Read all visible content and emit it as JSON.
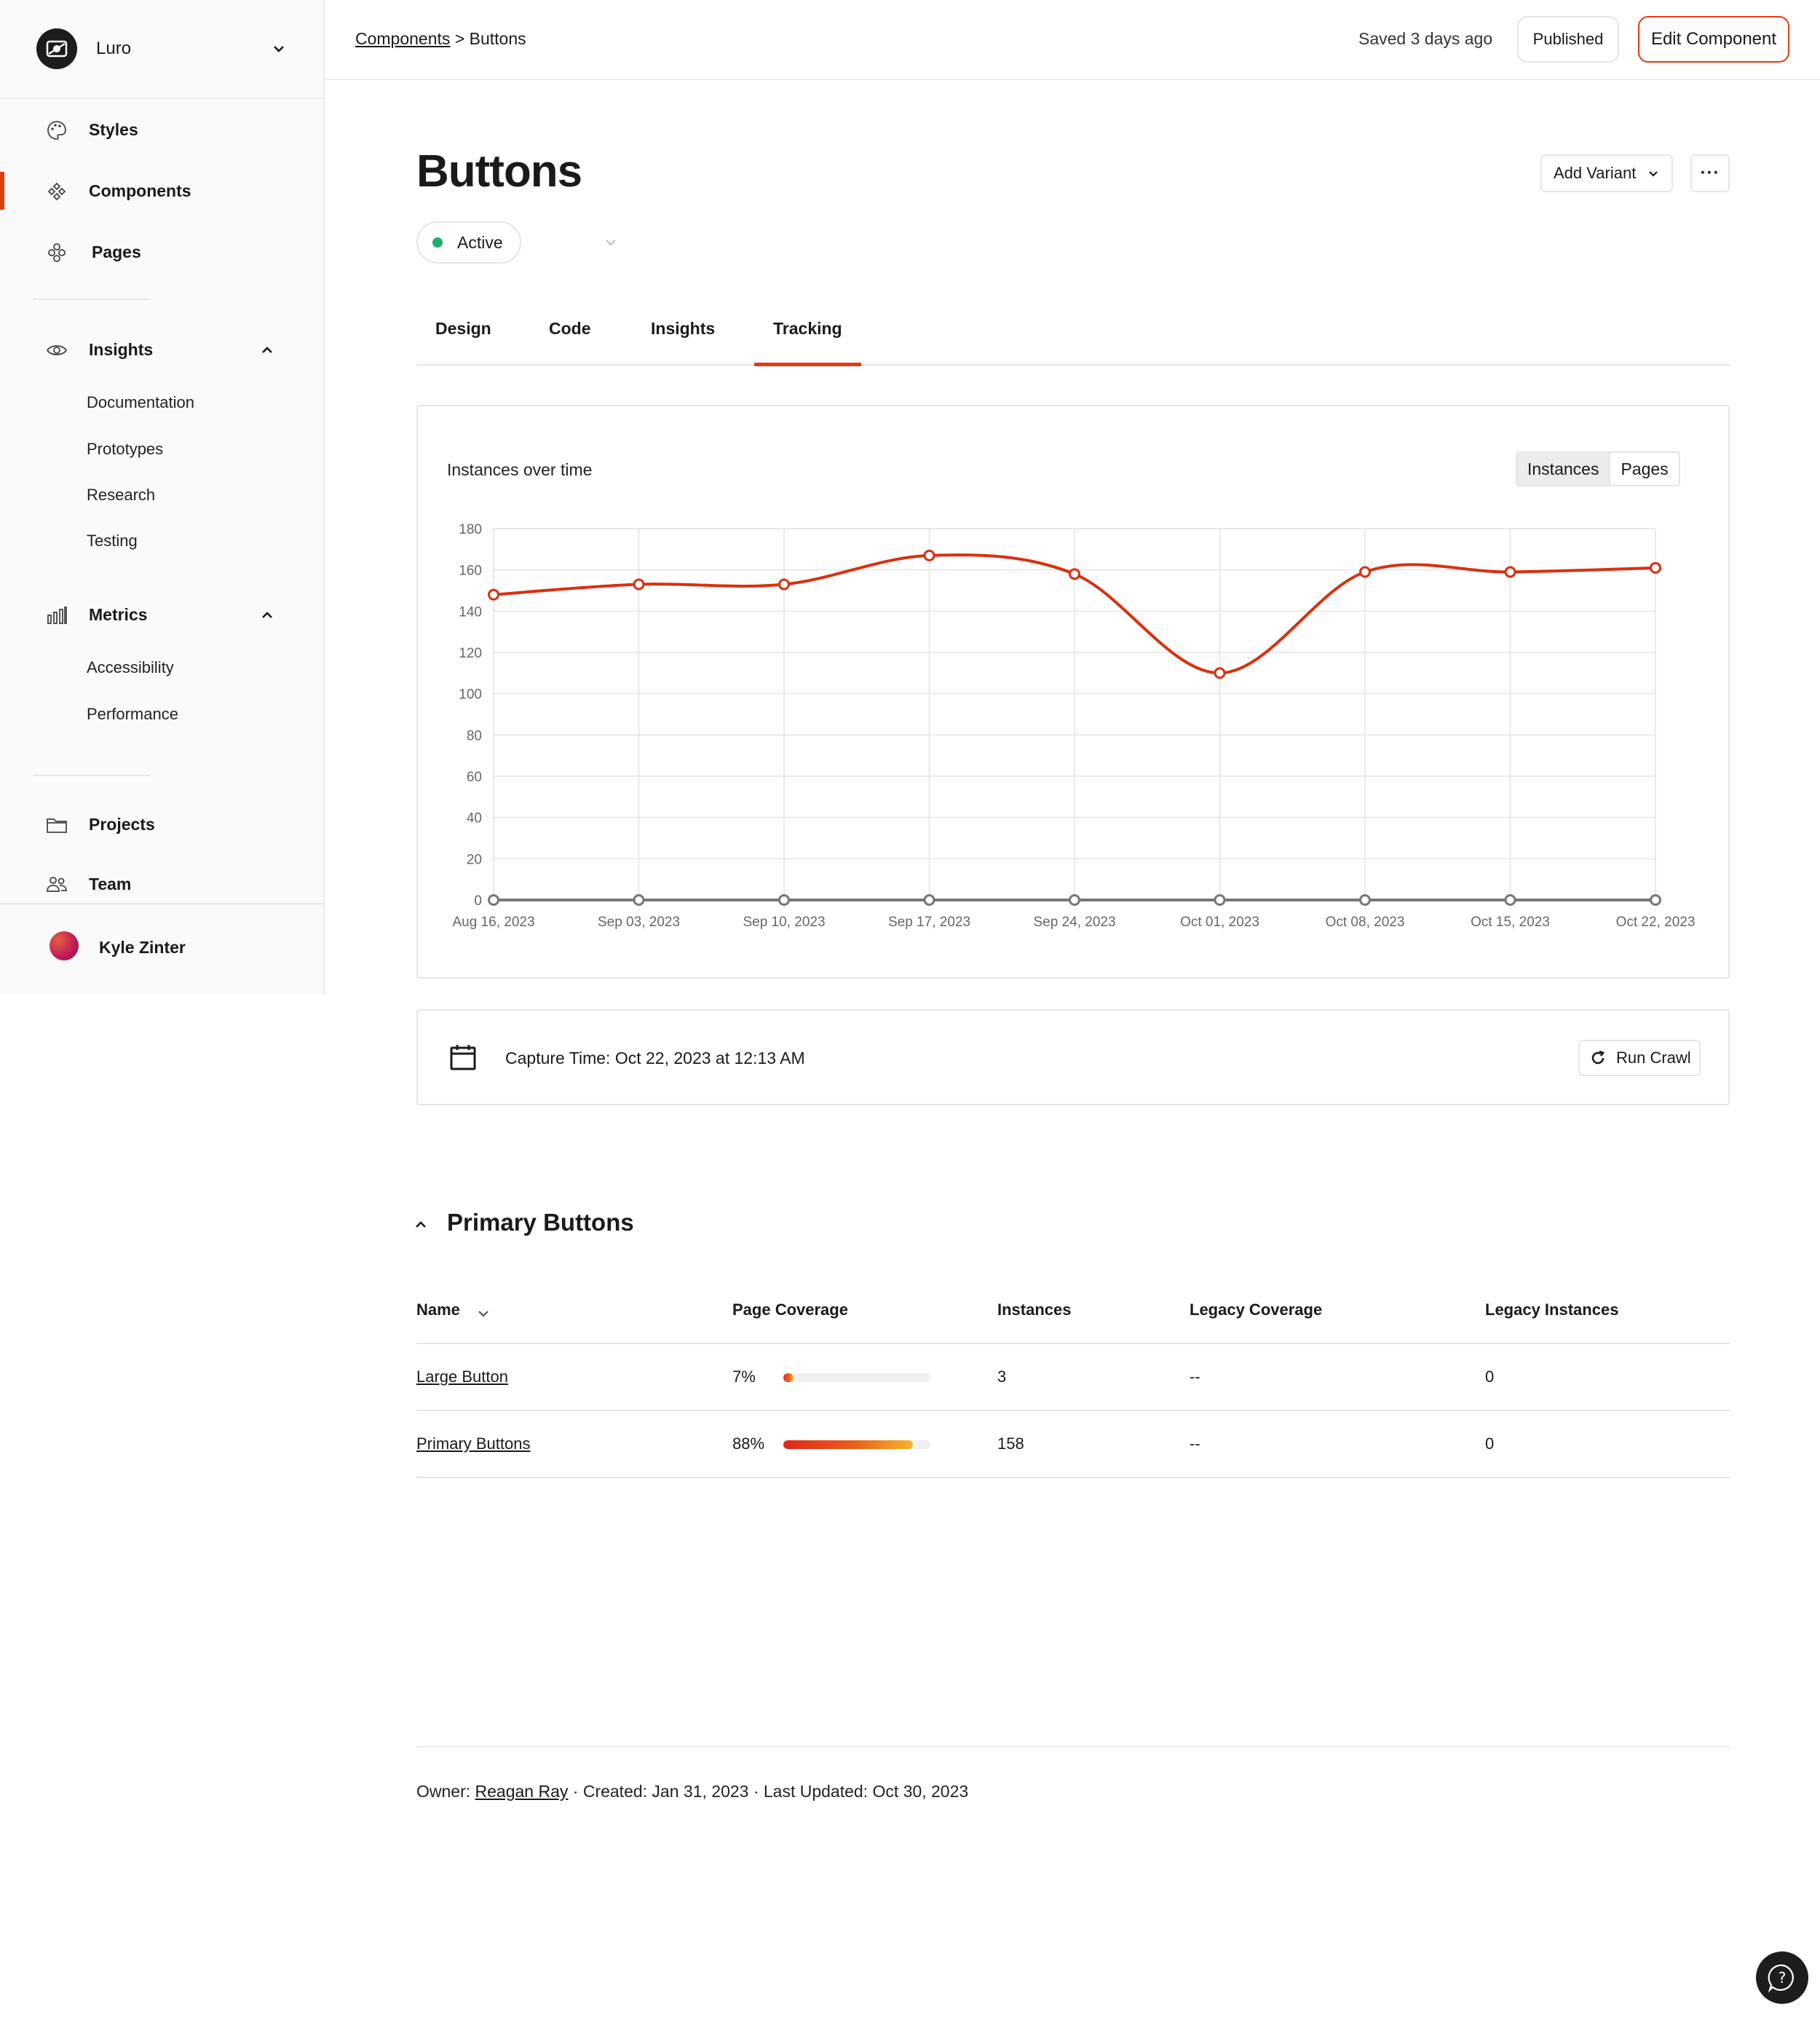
{
  "workspace": {
    "name": "Luro"
  },
  "nav": {
    "styles": "Styles",
    "components": "Components",
    "pages": "Pages",
    "insights": "Insights",
    "insights_items": [
      "Documentation",
      "Prototypes",
      "Research",
      "Testing"
    ],
    "metrics": "Metrics",
    "metrics_items": [
      "Accessibility",
      "Performance"
    ],
    "projects": "Projects",
    "team": "Team"
  },
  "user": {
    "name": "Kyle Zinter"
  },
  "breadcrumb": {
    "parent": "Components",
    "separator": ">",
    "current": "Buttons"
  },
  "topbar": {
    "saved": "Saved 3 days ago",
    "published": "Published",
    "edit": "Edit Component"
  },
  "page": {
    "title": "Buttons",
    "status": "Active",
    "add_variant": "Add Variant",
    "more": "···",
    "tabs": [
      "Design",
      "Code",
      "Insights",
      "Tracking"
    ],
    "active_tab": "Tracking"
  },
  "chart_card": {
    "title": "Instances over time",
    "toggle": [
      "Instances",
      "Pages"
    ],
    "toggle_active": "Instances"
  },
  "chart_data": {
    "type": "line",
    "title": "Instances over time",
    "x": [
      "Aug 16, 2023",
      "Sep 03, 2023",
      "Sep 10, 2023",
      "Sep 17, 2023",
      "Sep 24, 2023",
      "Oct 01, 2023",
      "Oct 08, 2023",
      "Oct 15, 2023",
      "Oct 22, 2023"
    ],
    "series": [
      {
        "values": [
          148,
          153,
          153,
          167,
          158,
          110,
          159,
          159,
          161
        ],
        "color": "#d9300f"
      },
      {
        "values": [
          0,
          0,
          0,
          0,
          0,
          0,
          0,
          0,
          0
        ],
        "color": "#777777"
      }
    ],
    "ylim": [
      0,
      180
    ],
    "yticks": [
      0,
      20,
      40,
      60,
      80,
      100,
      120,
      140,
      160,
      180
    ],
    "grid": true
  },
  "capture": {
    "text": "Capture Time: Oct 22, 2023 at 12:13 AM",
    "run_crawl": "Run Crawl"
  },
  "section": {
    "title": "Primary Buttons"
  },
  "table": {
    "headers": [
      "Name",
      "Page Coverage",
      "Instances",
      "Legacy Coverage",
      "Legacy Instances"
    ],
    "rows": [
      {
        "name": "Large Button",
        "coverage": "7%",
        "coverage_value": 0.07,
        "instances": "3",
        "legacy_coverage": "--",
        "legacy_instances": "0"
      },
      {
        "name": "Primary Buttons",
        "coverage": "88%",
        "coverage_value": 0.88,
        "instances": "158",
        "legacy_coverage": "--",
        "legacy_instances": "0"
      }
    ]
  },
  "footer": {
    "owner_label": "Owner:",
    "owner": "Reagan Ray",
    "rest": "· Created: Jan 31, 2023 · Last Updated: Oct 30, 2023"
  },
  "colors": {
    "accent": "#e23b12",
    "active_status": "#1fab6a"
  }
}
